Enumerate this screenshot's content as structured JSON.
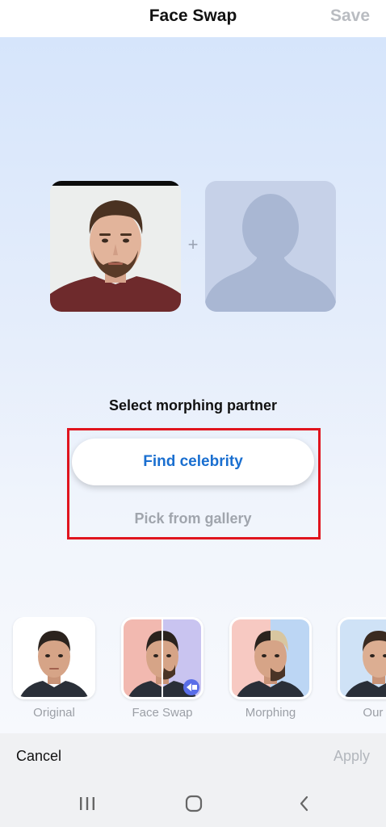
{
  "header": {
    "title": "Face Swap",
    "save_label": "Save"
  },
  "editor": {
    "plus_sign": "+",
    "prompt": "Select morphing partner",
    "find_celebrity_label": "Find celebrity",
    "pick_gallery_label": "Pick from gallery"
  },
  "filters": [
    {
      "label": "Original"
    },
    {
      "label": "Face Swap"
    },
    {
      "label": "Morphing"
    },
    {
      "label": "Our S"
    }
  ],
  "footer": {
    "cancel_label": "Cancel",
    "apply_label": "Apply"
  },
  "navigation": {
    "recents_icon": "recents-icon",
    "home_icon": "home-icon",
    "back_icon": "back-icon"
  },
  "colors": {
    "accent": "#1a6fd0",
    "highlight": "#e0141e",
    "muted": "#a0a5ad"
  }
}
